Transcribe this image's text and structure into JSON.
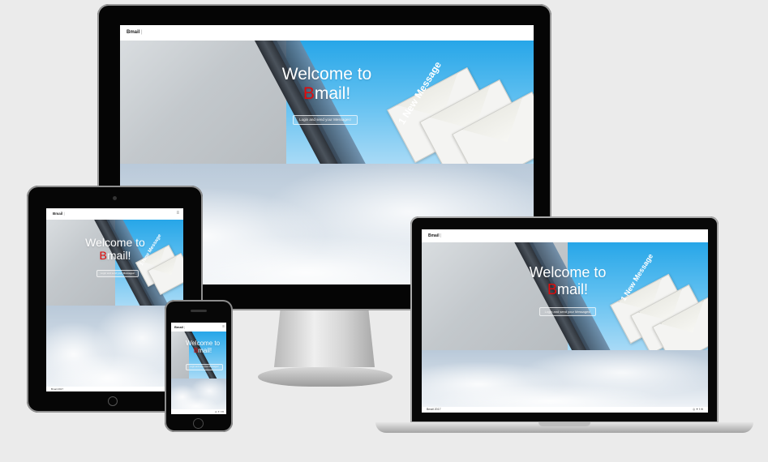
{
  "site": {
    "brand": "Bmail",
    "brand_separator": "|",
    "menu_icon": "hamburger-icon",
    "hero_title_line1": "Welcome to",
    "hero_title_b": "B",
    "hero_title_rest": "mail!",
    "hero_cta": "Login and send your Messages!",
    "hero_badge": "1 New Message",
    "footer_copy": "Bmail 2017",
    "social_icons": [
      "instagram-icon",
      "twitter-icon",
      "facebook-icon",
      "email-icon"
    ],
    "social_glyphs": [
      "◎",
      "✦",
      "f",
      "✉"
    ]
  },
  "colors": {
    "background": "#ebebeb",
    "accent_red": "#e10b0b",
    "sky_blue": "#27a6e8"
  }
}
